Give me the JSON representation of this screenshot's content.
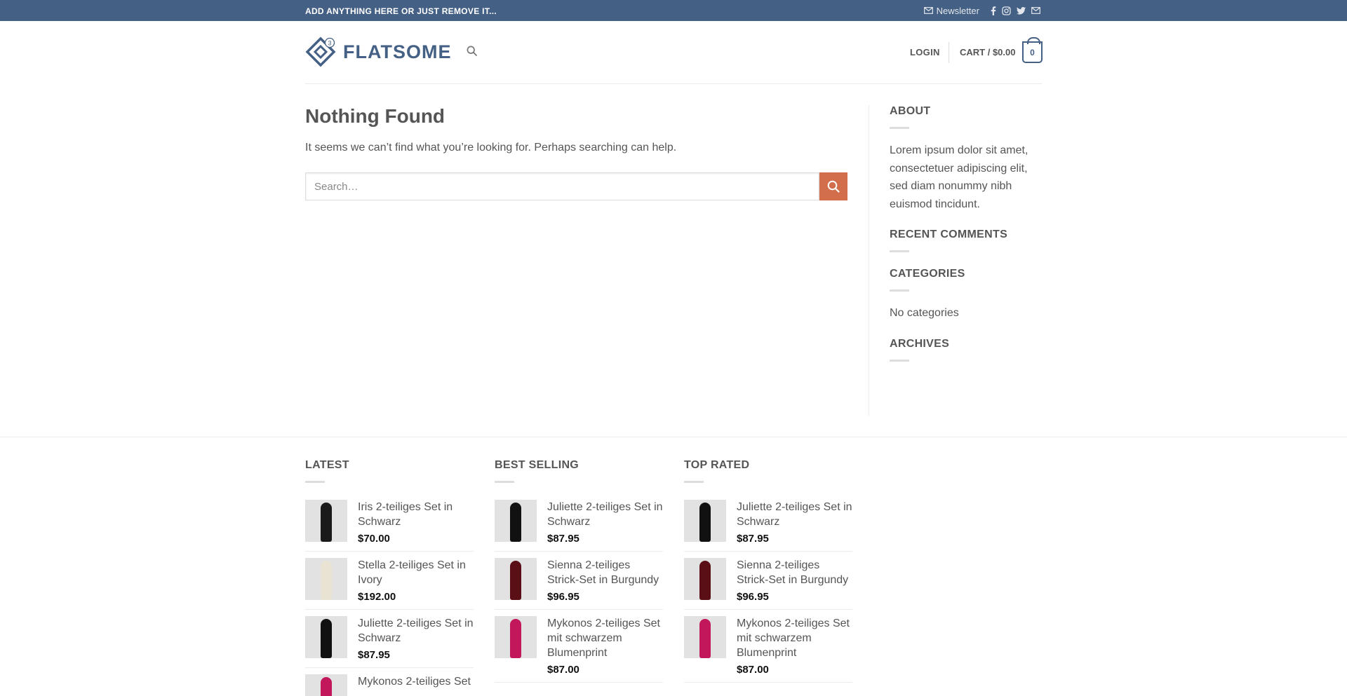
{
  "topbar": {
    "message": "ADD ANYTHING HERE OR JUST REMOVE IT...",
    "newsletter": "Newsletter",
    "social_icons": [
      "facebook-icon",
      "instagram-icon",
      "twitter-icon",
      "email-icon"
    ]
  },
  "header": {
    "logo_text": "FLATSOME",
    "logo_badge": "3",
    "login": "LOGIN",
    "cart_label": "CART / $0.00",
    "cart_count": "0"
  },
  "main": {
    "title": "Nothing Found",
    "text": "It seems we can’t find what you’re looking for. Perhaps searching can help.",
    "search_placeholder": "Search…"
  },
  "sidebar": {
    "about_title": "ABOUT",
    "about_text": "Lorem ipsum dolor sit amet, consectetuer adipiscing elit, sed diam nonummy nibh euismod tincidunt.",
    "recent_comments_title": "RECENT COMMENTS",
    "categories_title": "CATEGORIES",
    "categories_text": "No categories",
    "archives_title": "ARCHIVES"
  },
  "footer": {
    "latest": {
      "title": "LATEST",
      "items": [
        {
          "name": "Iris 2-teiliges Set in Schwarz",
          "price": "$70.00",
          "color": "#1a1a1a"
        },
        {
          "name": "Stella 2-teiliges Set in Ivory",
          "price": "$192.00",
          "color": "#e9e3d3"
        },
        {
          "name": "Juliette 2-teiliges Set in Schwarz",
          "price": "$87.95",
          "color": "#111111"
        },
        {
          "name": "Mykonos 2-teiliges Set",
          "price": "",
          "color": "#c2185b"
        }
      ]
    },
    "best_selling": {
      "title": "BEST SELLING",
      "items": [
        {
          "name": "Juliette 2-teiliges Set in Schwarz",
          "price": "$87.95",
          "color": "#111111"
        },
        {
          "name": "Sienna 2-teiliges Strick-Set in Burgundy",
          "price": "$96.95",
          "color": "#5a0e16"
        },
        {
          "name": "Mykonos 2-teiliges Set mit schwarzem Blumenprint",
          "price": "$87.00",
          "color": "#c2185b"
        }
      ]
    },
    "top_rated": {
      "title": "TOP RATED",
      "items": [
        {
          "name": "Juliette 2-teiliges Set in Schwarz",
          "price": "$87.95",
          "color": "#111111"
        },
        {
          "name": "Sienna 2-teiliges Strick-Set in Burgundy",
          "price": "$96.95",
          "color": "#5a0e16"
        },
        {
          "name": "Mykonos 2-teiliges Set mit schwarzem Blumenprint",
          "price": "$87.00",
          "color": "#c2185b"
        }
      ]
    }
  },
  "colors": {
    "primary": "#446084",
    "accent": "#d26e4b"
  }
}
